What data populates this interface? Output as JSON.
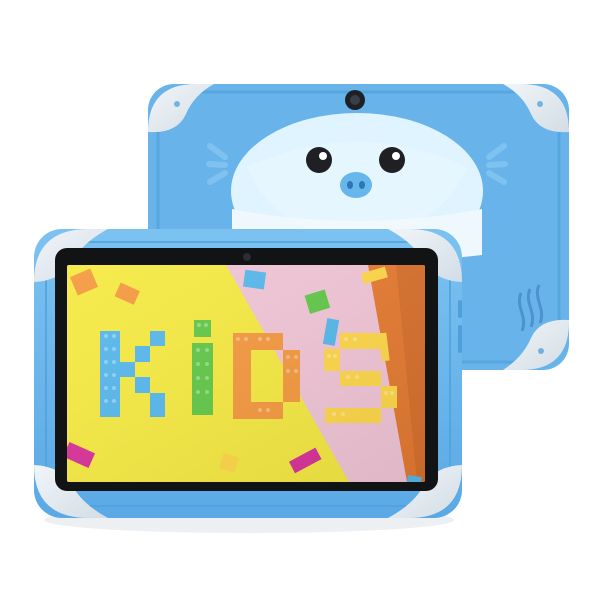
{
  "product": {
    "screen_text": "KIDS",
    "colors": {
      "case_blue": "#6ab5ec",
      "case_blue_dark": "#4f9fdb",
      "bumper_gray": "#dfe7ee",
      "screen_black": "#111214",
      "yellow_panel": "#f6ea43",
      "pink_panel": "#f2c6d7",
      "orange_panel": "#e57b32",
      "brick_blue": "#58b8ec",
      "brick_green": "#63c94a",
      "brick_orange": "#f59a40",
      "brick_yellow": "#ffd84a",
      "brick_magenta": "#d9339a"
    },
    "icons": {
      "front_camera": "camera-icon",
      "rear_camera": "camera-icon",
      "speaker": "speaker-icon",
      "back_face": "cartoon-face-icon"
    }
  }
}
